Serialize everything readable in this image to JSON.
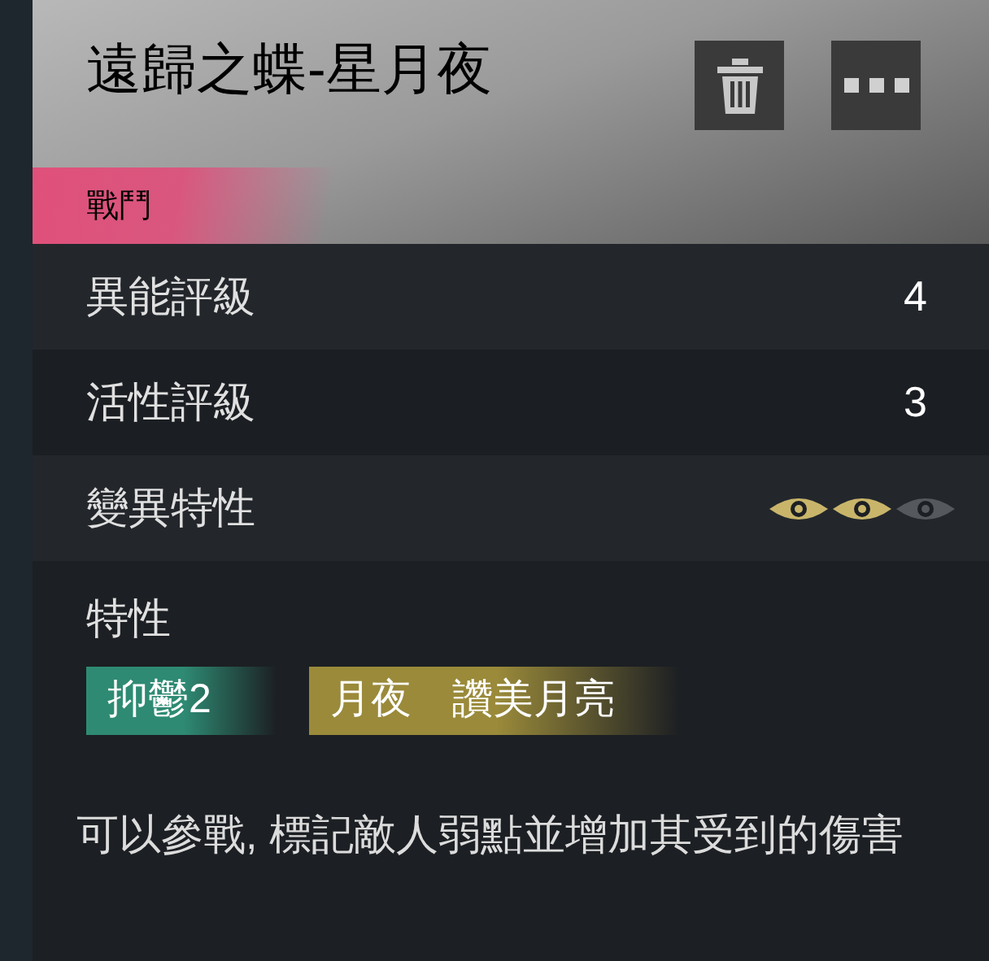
{
  "header": {
    "title": "遠歸之蝶-星月夜",
    "category": "戰鬥"
  },
  "stats": [
    {
      "label": "異能評級",
      "kind": "value",
      "value": "4"
    },
    {
      "label": "活性評級",
      "kind": "value",
      "value": "3"
    },
    {
      "label": "變異特性",
      "kind": "eyes",
      "eyes": [
        {
          "filled": true
        },
        {
          "filled": true
        },
        {
          "filled": false
        }
      ]
    }
  ],
  "traits": {
    "label": "特性",
    "tags": [
      {
        "text": "抑鬱2",
        "color": "#2e8a73"
      },
      {
        "text": "月夜　讚美月亮",
        "color": "#9a8a3a"
      }
    ]
  },
  "description": "可以參戰, 標記敵人弱點並增加其受到的傷害"
}
